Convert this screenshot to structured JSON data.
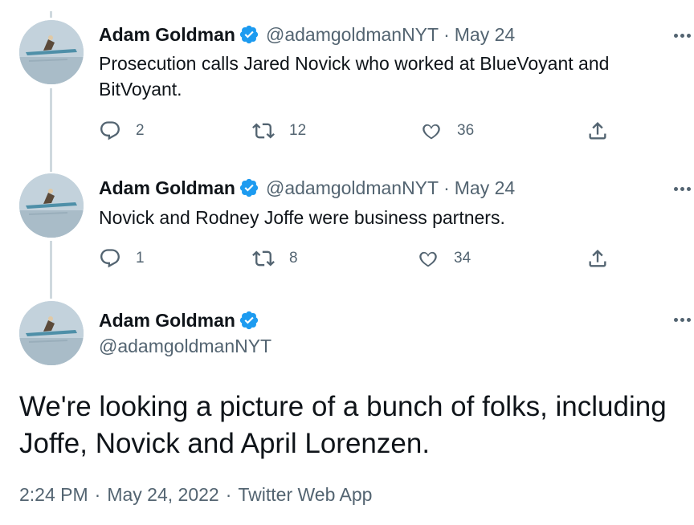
{
  "tweets": [
    {
      "author": {
        "name": "Adam Goldman",
        "handle": "@adamgoldmanNYT"
      },
      "separator": "·",
      "date": "May 24",
      "text": "Prosecution calls Jared Novick who worked at BlueVoyant and BitVoyant.",
      "replies": "2",
      "retweets": "12",
      "likes": "36"
    },
    {
      "author": {
        "name": "Adam Goldman",
        "handle": "@adamgoldmanNYT"
      },
      "separator": "·",
      "date": "May 24",
      "text": "Novick and Rodney Joffe were business partners.",
      "replies": "1",
      "retweets": "8",
      "likes": "34"
    }
  ],
  "main_tweet": {
    "author": {
      "name": "Adam Goldman",
      "handle": "@adamgoldmanNYT"
    },
    "text": "We're looking a picture of a bunch of folks, including Joffe, Novick and April Lorenzen.",
    "time": "2:24 PM",
    "date": "May 24, 2022",
    "source": "Twitter Web App",
    "separator": "·"
  },
  "icons": {
    "verified": "verified-badge-icon",
    "reply": "reply-icon",
    "retweet": "retweet-icon",
    "like": "heart-icon",
    "share": "share-icon",
    "more": "more-icon"
  },
  "colors": {
    "verified": "#1d9bf0",
    "text": "#0f1419",
    "secondary": "#536471",
    "thread_line": "#cfd9de"
  }
}
